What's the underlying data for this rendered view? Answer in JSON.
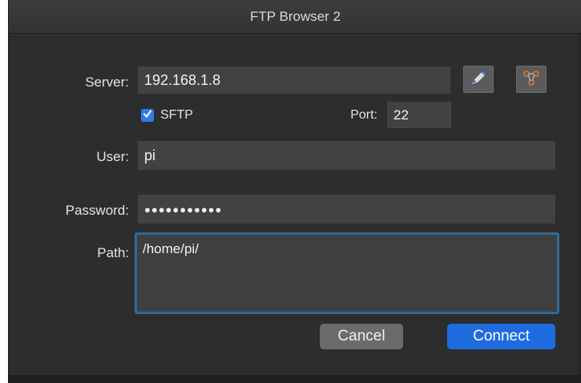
{
  "window": {
    "title": "FTP Browser 2"
  },
  "form": {
    "server_label": "Server:",
    "server_value": "192.168.1.8",
    "sftp_label": "SFTP",
    "sftp_checked": true,
    "port_label": "Port:",
    "port_value": "22",
    "user_label": "User:",
    "user_value": "pi",
    "password_label": "Password:",
    "password_value": "●●●●●●●●●●●",
    "path_label": "Path:",
    "path_value": "/home/pi/"
  },
  "buttons": {
    "cancel_label": "Cancel",
    "connect_label": "Connect"
  },
  "icons": {
    "bookmark": "pen-icon",
    "network": "network-icon"
  },
  "colors": {
    "accent": "#1e6ce0",
    "focus_ring": "#2f6b95",
    "background": "#2d2d2e"
  }
}
